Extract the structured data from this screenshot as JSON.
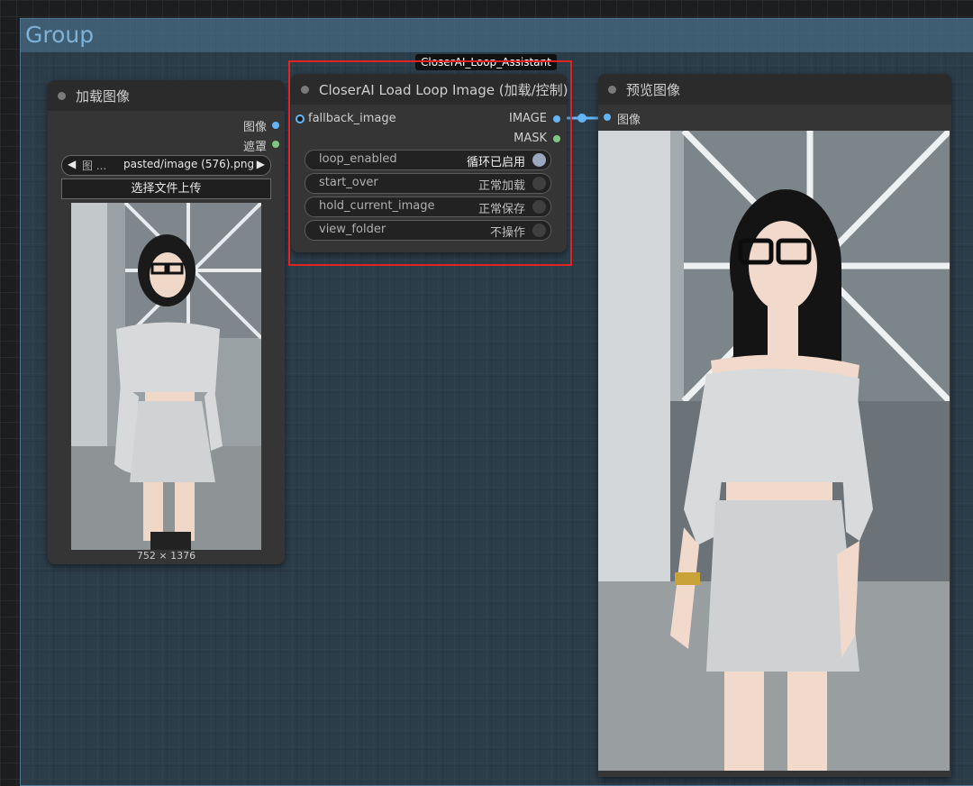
{
  "group": {
    "title": "Group"
  },
  "load_node": {
    "title": "加载图像",
    "outputs": [
      "图像",
      "遮罩"
    ],
    "image_combo": {
      "prefix": "图 ...",
      "value": "pasted/image (576).png"
    },
    "upload_button": "选择文件上传",
    "image_size": "752 × 1376"
  },
  "loop_node": {
    "badge": "CloserAI_Loop_Assistant",
    "title": "CloserAI Load Loop Image (加载/控制)",
    "input": "fallback_image",
    "outputs": [
      "IMAGE",
      "MASK"
    ],
    "widgets": [
      {
        "label": "loop_enabled",
        "value": "循环已启用",
        "on": true
      },
      {
        "label": "start_over",
        "value": "正常加载",
        "on": false
      },
      {
        "label": "hold_current_image",
        "value": "正常保存",
        "on": false
      },
      {
        "label": "view_folder",
        "value": "不操作",
        "on": false
      }
    ]
  },
  "preview_node": {
    "title": "预览图像",
    "input": "图像"
  },
  "colors": {
    "image_slot": "#64b5f6",
    "mask_slot": "#81c784",
    "highlight": "#e02424"
  }
}
